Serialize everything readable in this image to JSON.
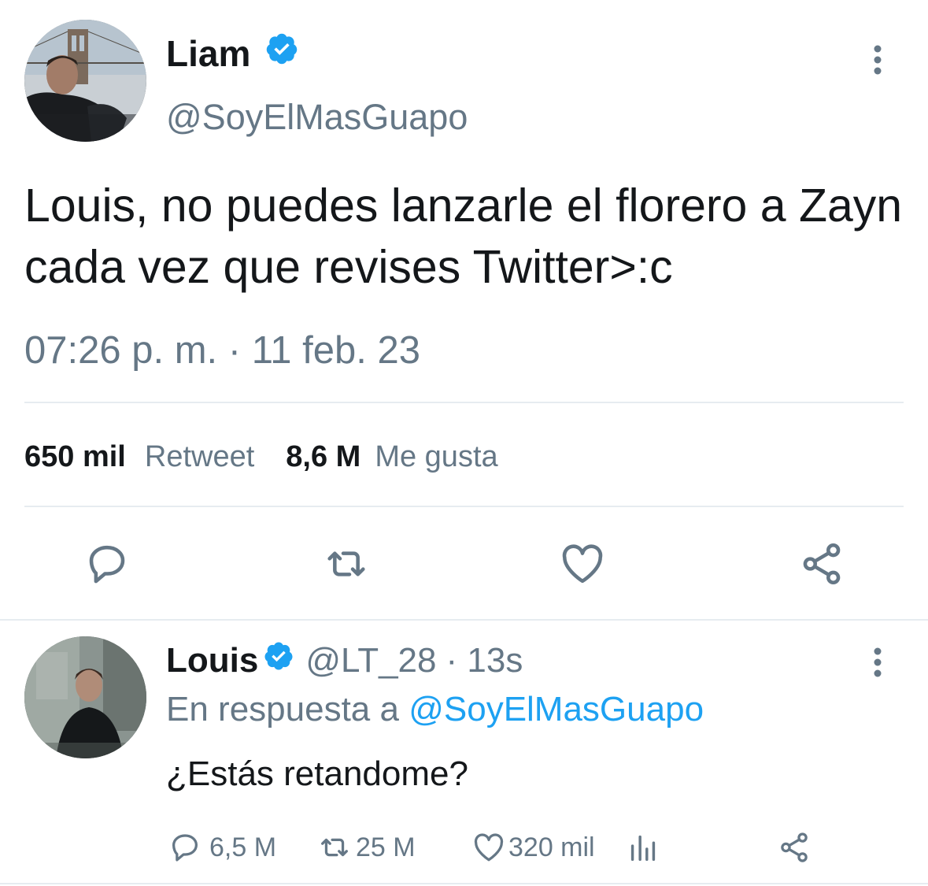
{
  "main_tweet": {
    "author_name": "Liam",
    "author_handle": "@SoyElMasGuapo",
    "verified": true,
    "text": "Louis, no puedes lanzarle el florero a Zayn cada vez que revises Twitter>:c",
    "timestamp": "07:26 p. m. · 11 feb. 23",
    "stats": {
      "retweets_count": "650 mil",
      "retweets_label": "Retweet",
      "likes_count": "8,6 M",
      "likes_label": "Me gusta"
    },
    "actions": [
      "reply-icon",
      "retweet-icon",
      "like-icon",
      "share-icon"
    ]
  },
  "reply_tweet": {
    "author_name": "Louis",
    "author_handle": "@LT_28",
    "time_ago": "· 13s",
    "verified": true,
    "reply_prefix": "En respuesta a",
    "reply_mention": "@SoyElMasGuapo",
    "text": "¿Estás retandome?",
    "counts": {
      "replies": "6,5 M",
      "retweets": "25 M",
      "likes": "320 mil"
    }
  },
  "colors": {
    "text_primary": "#14171a",
    "text_secondary": "#657786",
    "accent_blue": "#1da1f2",
    "divider": "#e6ecf0"
  }
}
